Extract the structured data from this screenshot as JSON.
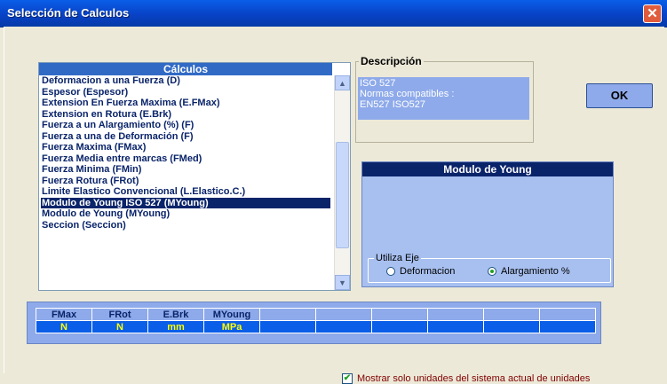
{
  "window": {
    "title": "Selección de Calculos",
    "close_glyph": "✕"
  },
  "calculos": {
    "header": "Cálculos",
    "items": [
      "Deformacion a una Fuerza (D)",
      "Espesor (Espesor)",
      "Extension En Fuerza Maxima (E.FMax)",
      "Extension en Rotura (E.Brk)",
      "Fuerza a un Alargamiento (%) (F)",
      "Fuerza a una de Deformación (F)",
      "Fuerza Maxima (FMax)",
      "Fuerza Media entre marcas (FMed)",
      "Fuerza Minima (FMin)",
      "Fuerza Rotura (FRot)",
      "Limite Elastico Convencional (L.Elastico.C.)",
      "Modulo de Young ISO 527 (MYoung)",
      "Modulo de Young (MYoung)",
      "Seccion (Seccion)"
    ],
    "selected_index": 11,
    "scroll_up": "▲",
    "scroll_down": "▼"
  },
  "descripcion": {
    "label": "Descripción",
    "line1": "ISO 527",
    "line2": "Normas compatibles :",
    "line3": "EN527 ISO527"
  },
  "ok_label": "OK",
  "young": {
    "header": "Modulo de Young",
    "eje_label": "Utiliza Eje",
    "options": [
      "Deformacion",
      "Alargamiento %"
    ],
    "selected": "Alargamiento %"
  },
  "units": {
    "headers": [
      "FMax",
      "FRot",
      "E.Brk",
      "MYoung",
      "",
      "",
      "",
      "",
      "",
      ""
    ],
    "values": [
      "N",
      "N",
      "mm",
      "MPa",
      "",
      "",
      "",
      "",
      "",
      ""
    ]
  },
  "mostrar": {
    "label": "Mostrar solo unidades del sistema actual de unidades",
    "checked": true,
    "check_glyph": "✔"
  },
  "colors": {
    "title_bar": "#0842c6",
    "selection": "#0a246a",
    "panel": "#8eaaea",
    "unit_text": "#ffff00"
  }
}
